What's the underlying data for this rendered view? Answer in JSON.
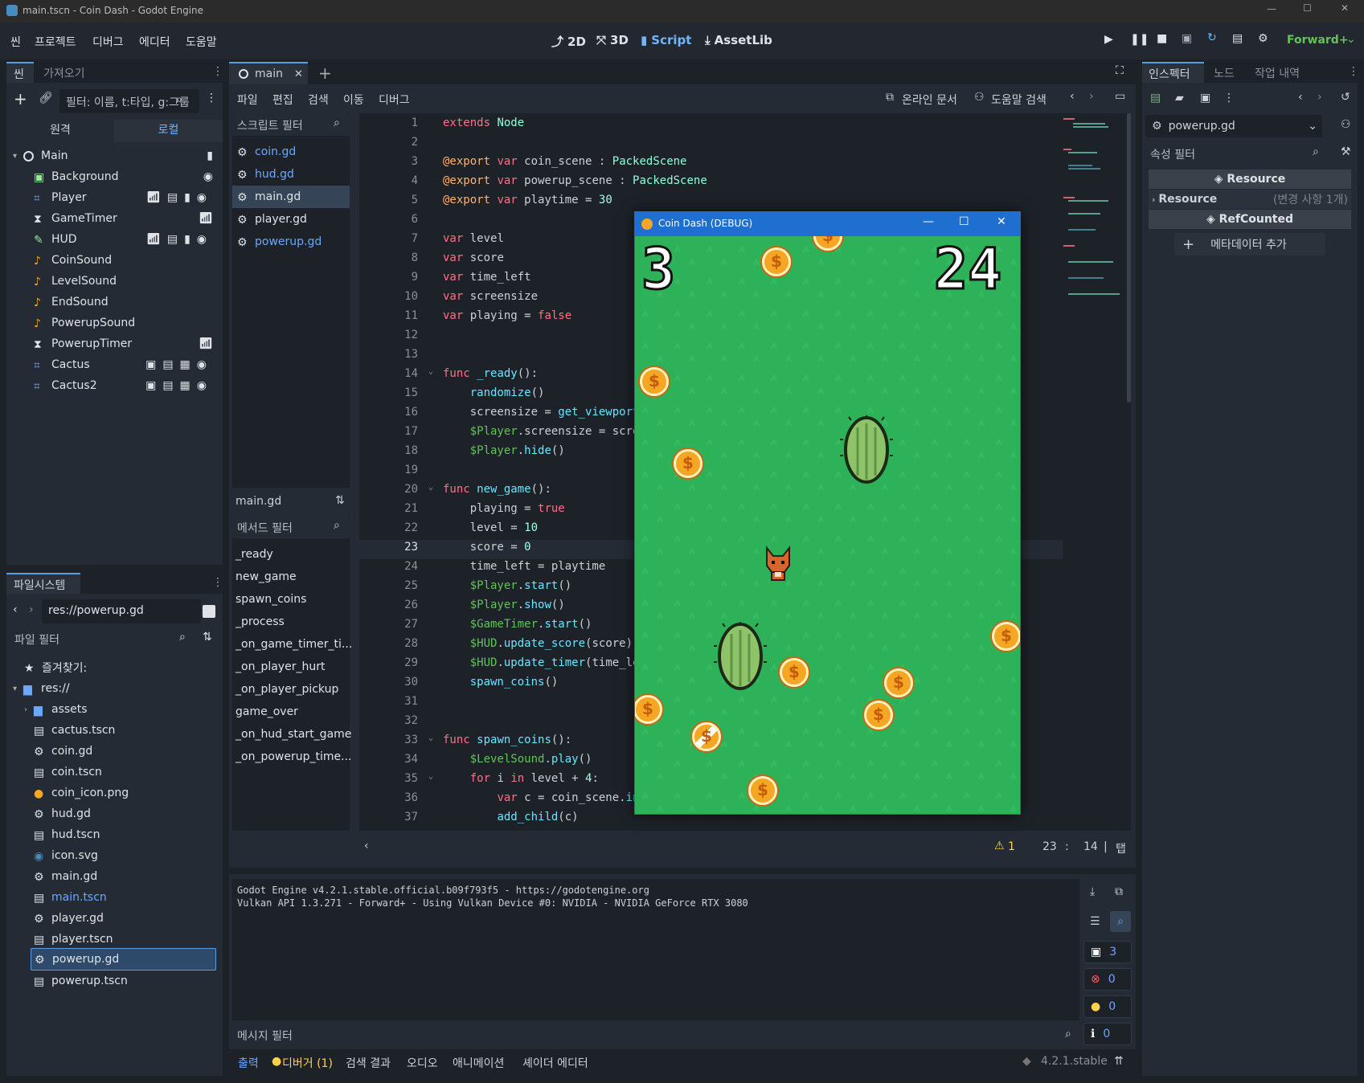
{
  "window": {
    "title": "main.tscn - Coin Dash - Godot Engine"
  },
  "menubar": {
    "items": [
      "씬",
      "프로젝트",
      "디버그",
      "에디터",
      "도움말"
    ],
    "workspaces": [
      "2D",
      "3D",
      "Script",
      "AssetLib"
    ],
    "renderer": "Forward+"
  },
  "scene_dock": {
    "tabs": [
      "씬",
      "가져오기"
    ],
    "filter_placeholder": "필터: 이름, t:타입, g:그룹",
    "remote_label": "원격",
    "local_label": "로컬",
    "nodes": [
      "Main",
      "Background",
      "Player",
      "GameTimer",
      "HUD",
      "CoinSound",
      "LevelSound",
      "EndSound",
      "PowerupSound",
      "PowerupTimer",
      "Cactus",
      "Cactus2"
    ]
  },
  "filesystem": {
    "tab": "파일시스템",
    "path": "res://powerup.gd",
    "filter_placeholder": "파일 필터",
    "favorites": "즐겨찾기:",
    "root": "res://",
    "entries": [
      "assets",
      "cactus.tscn",
      "coin.gd",
      "coin.tscn",
      "coin_icon.png",
      "hud.gd",
      "hud.tscn",
      "icon.svg",
      "main.gd",
      "main.tscn",
      "player.gd",
      "player.tscn",
      "powerup.gd",
      "powerup.tscn"
    ]
  },
  "script_editor": {
    "tab": "main",
    "menu": [
      "파일",
      "편집",
      "검색",
      "이동",
      "디버그"
    ],
    "online_docs": "온라인 문서",
    "help_search": "도움말 검색",
    "script_filter": "스크립트 필터",
    "scripts": [
      "coin.gd",
      "hud.gd",
      "main.gd",
      "player.gd",
      "powerup.gd"
    ],
    "current_script": "main.gd",
    "method_filter": "메서드 필터",
    "methods": [
      "_ready",
      "new_game",
      "spawn_coins",
      "_process",
      "_on_game_timer_ti...",
      "_on_player_hurt",
      "_on_player_pickup",
      "game_over",
      "_on_hud_start_game",
      "_on_powerup_time..."
    ],
    "line_numbers": [
      "1",
      "2",
      "3",
      "4",
      "5",
      "6",
      "7",
      "8",
      "9",
      "10",
      "11",
      "12",
      "13",
      "14",
      "15",
      "16",
      "17",
      "18",
      "19",
      "20",
      "21",
      "22",
      "23",
      "24",
      "25",
      "26",
      "27",
      "28",
      "29",
      "30",
      "31",
      "32",
      "33",
      "34",
      "35",
      "36",
      "37"
    ],
    "status": {
      "warnings": "1",
      "line": "23",
      "col": "14",
      "indent": "탭"
    }
  },
  "game_window": {
    "title": "Coin Dash (DEBUG)",
    "level": "3",
    "time": "24",
    "coin_symbol": "$"
  },
  "output": {
    "lines": [
      "Godot Engine v4.2.1.stable.official.b09f793f5 - https://godotengine.org",
      "Vulkan API 1.3.271 - Forward+ - Using Vulkan Device #0: NVIDIA - NVIDIA GeForce RTX 3080"
    ],
    "message_filter": "메시지 필터",
    "counts": {
      "messages": "3",
      "errors": "0",
      "warnings": "0",
      "info": "0"
    }
  },
  "bottom_panel": {
    "tabs": [
      "출력",
      "디버거 (1)",
      "검색 결과",
      "오디오",
      "애니메이션",
      "셰이더 에디터"
    ],
    "version": "4.2.1.stable"
  },
  "inspector": {
    "tabs": [
      "인스펙터",
      "노드",
      "작업 내역"
    ],
    "resource": "powerup.gd",
    "property_filter": "속성 필터",
    "sections": {
      "resource": "Resource",
      "resource_row": "Resource",
      "changes": "(변경 사항 1개)",
      "refcounted": "RefCounted",
      "add_metadata": "메타데이터 추가"
    }
  },
  "colors": {
    "accent": "#5a9de6",
    "game_bg": "#2db25a",
    "coin": "#f5a623"
  }
}
